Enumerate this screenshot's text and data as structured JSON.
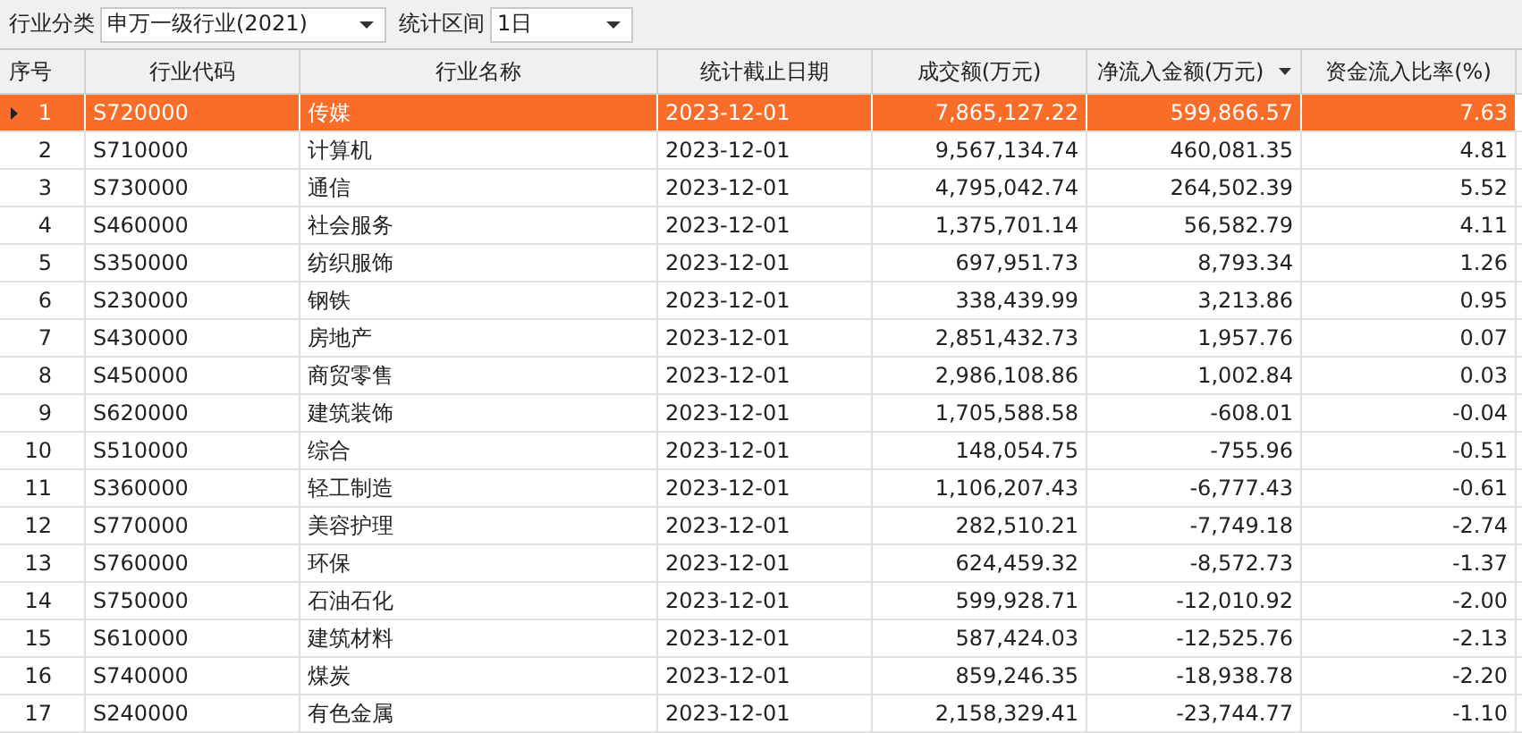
{
  "toolbar": {
    "category_label": "行业分类",
    "category_value": "申万一级行业(2021)",
    "period_label": "统计区间",
    "period_value": "1日"
  },
  "table": {
    "columns": [
      {
        "label": "序号",
        "sorted": false
      },
      {
        "label": "行业代码",
        "sorted": false
      },
      {
        "label": "行业名称",
        "sorted": false
      },
      {
        "label": "统计截止日期",
        "sorted": false
      },
      {
        "label": "成交额(万元)",
        "sorted": false
      },
      {
        "label": "净流入金额(万元)",
        "sorted": true
      },
      {
        "label": "资金流入比率(%)",
        "sorted": false
      }
    ],
    "rows": [
      {
        "selected": true,
        "cells": [
          "1",
          "S720000",
          "传媒",
          "2023-12-01",
          "7,865,127.22",
          "599,866.57",
          "7.63"
        ]
      },
      {
        "selected": false,
        "cells": [
          "2",
          "S710000",
          "计算机",
          "2023-12-01",
          "9,567,134.74",
          "460,081.35",
          "4.81"
        ]
      },
      {
        "selected": false,
        "cells": [
          "3",
          "S730000",
          "通信",
          "2023-12-01",
          "4,795,042.74",
          "264,502.39",
          "5.52"
        ]
      },
      {
        "selected": false,
        "cells": [
          "4",
          "S460000",
          "社会服务",
          "2023-12-01",
          "1,375,701.14",
          "56,582.79",
          "4.11"
        ]
      },
      {
        "selected": false,
        "cells": [
          "5",
          "S350000",
          "纺织服饰",
          "2023-12-01",
          "697,951.73",
          "8,793.34",
          "1.26"
        ]
      },
      {
        "selected": false,
        "cells": [
          "6",
          "S230000",
          "钢铁",
          "2023-12-01",
          "338,439.99",
          "3,213.86",
          "0.95"
        ]
      },
      {
        "selected": false,
        "cells": [
          "7",
          "S430000",
          "房地产",
          "2023-12-01",
          "2,851,432.73",
          "1,957.76",
          "0.07"
        ]
      },
      {
        "selected": false,
        "cells": [
          "8",
          "S450000",
          "商贸零售",
          "2023-12-01",
          "2,986,108.86",
          "1,002.84",
          "0.03"
        ]
      },
      {
        "selected": false,
        "cells": [
          "9",
          "S620000",
          "建筑装饰",
          "2023-12-01",
          "1,705,588.58",
          "-608.01",
          "-0.04"
        ]
      },
      {
        "selected": false,
        "cells": [
          "10",
          "S510000",
          "综合",
          "2023-12-01",
          "148,054.75",
          "-755.96",
          "-0.51"
        ]
      },
      {
        "selected": false,
        "cells": [
          "11",
          "S360000",
          "轻工制造",
          "2023-12-01",
          "1,106,207.43",
          "-6,777.43",
          "-0.61"
        ]
      },
      {
        "selected": false,
        "cells": [
          "12",
          "S770000",
          "美容护理",
          "2023-12-01",
          "282,510.21",
          "-7,749.18",
          "-2.74"
        ]
      },
      {
        "selected": false,
        "cells": [
          "13",
          "S760000",
          "环保",
          "2023-12-01",
          "624,459.32",
          "-8,572.73",
          "-1.37"
        ]
      },
      {
        "selected": false,
        "cells": [
          "14",
          "S750000",
          "石油石化",
          "2023-12-01",
          "599,928.71",
          "-12,010.92",
          "-2.00"
        ]
      },
      {
        "selected": false,
        "cells": [
          "15",
          "S610000",
          "建筑材料",
          "2023-12-01",
          "587,424.03",
          "-12,525.76",
          "-2.13"
        ]
      },
      {
        "selected": false,
        "cells": [
          "16",
          "S740000",
          "煤炭",
          "2023-12-01",
          "859,246.35",
          "-18,938.78",
          "-2.20"
        ]
      },
      {
        "selected": false,
        "cells": [
          "17",
          "S240000",
          "有色金属",
          "2023-12-01",
          "2,158,329.41",
          "-23,744.77",
          "-1.10"
        ]
      }
    ]
  }
}
